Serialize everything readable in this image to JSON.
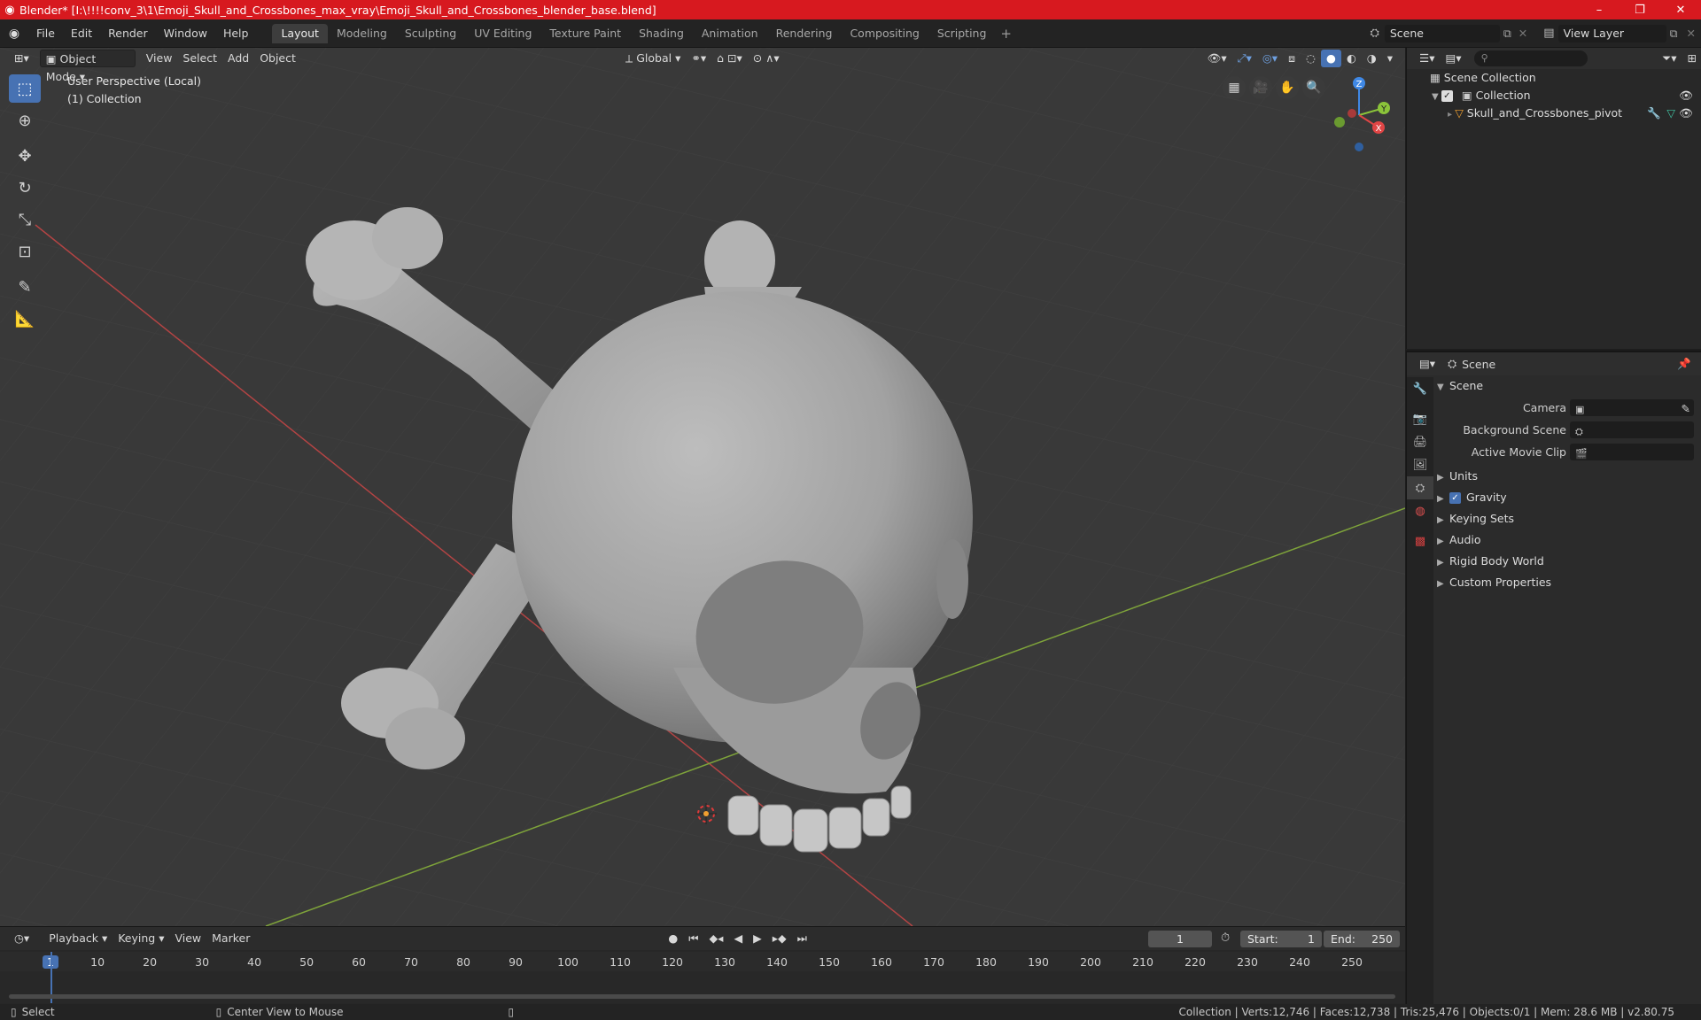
{
  "window": {
    "title": "Blender* [I:\\!!!!conv_3\\1\\Emoji_Skull_and_Crossbones_max_vray\\Emoji_Skull_and_Crossbones_blender_base.blend]",
    "minimize": "–",
    "maximize": "❐",
    "close": "✕"
  },
  "menu": [
    "File",
    "Edit",
    "Render",
    "Window",
    "Help"
  ],
  "workspaces": [
    "Layout",
    "Modeling",
    "Sculpting",
    "UV Editing",
    "Texture Paint",
    "Shading",
    "Animation",
    "Rendering",
    "Compositing",
    "Scripting"
  ],
  "active_workspace": "Layout",
  "add_workspace": "+",
  "scene_selector": "Scene",
  "view_layer_selector": "View Layer",
  "viewport": {
    "mode": "Object Mode",
    "menus": [
      "View",
      "Select",
      "Add",
      "Object"
    ],
    "orientation": "Global",
    "perspective_label": "User Perspective (Local)",
    "collection_label": "(1) Collection",
    "gizmo": {
      "x": "X",
      "y": "Y",
      "z": "Z"
    }
  },
  "timeline": {
    "menus": [
      "Playback",
      "Keying",
      "View",
      "Marker"
    ],
    "current_frame": "1",
    "start_label": "Start:",
    "start_value": "1",
    "end_label": "End:",
    "end_value": "250",
    "ticks": [
      "1",
      "10",
      "20",
      "30",
      "40",
      "50",
      "60",
      "70",
      "80",
      "90",
      "100",
      "110",
      "120",
      "130",
      "140",
      "150",
      "160",
      "170",
      "180",
      "190",
      "200",
      "210",
      "220",
      "230",
      "240",
      "250"
    ]
  },
  "statusbar": {
    "select": "Select",
    "center_view": "Center View to Mouse",
    "stats": "Collection | Verts:12,746 | Faces:12,738 | Tris:25,476 | Objects:0/1 | Mem: 28.6 MB | v2.80.75"
  },
  "outliner": {
    "root": "Scene Collection",
    "collection": "Collection",
    "object": "Skull_and_Crossbones_pivot"
  },
  "properties": {
    "context": "Scene",
    "panel": "Scene",
    "fields": [
      {
        "label": "Camera"
      },
      {
        "label": "Background Scene"
      },
      {
        "label": "Active Movie Clip"
      }
    ],
    "subpanels": [
      {
        "label": "Units",
        "checkbox": false
      },
      {
        "label": "Gravity",
        "checkbox": true
      },
      {
        "label": "Keying Sets",
        "checkbox": false
      },
      {
        "label": "Audio",
        "checkbox": false
      },
      {
        "label": "Rigid Body World",
        "checkbox": false
      },
      {
        "label": "Custom Properties",
        "checkbox": false
      }
    ]
  },
  "colors": {
    "titlebar": "#d7191f",
    "accent": "#4772b3",
    "x_axis": "#e04545",
    "y_axis": "#8bc43a",
    "z_axis": "#3f88e5"
  }
}
